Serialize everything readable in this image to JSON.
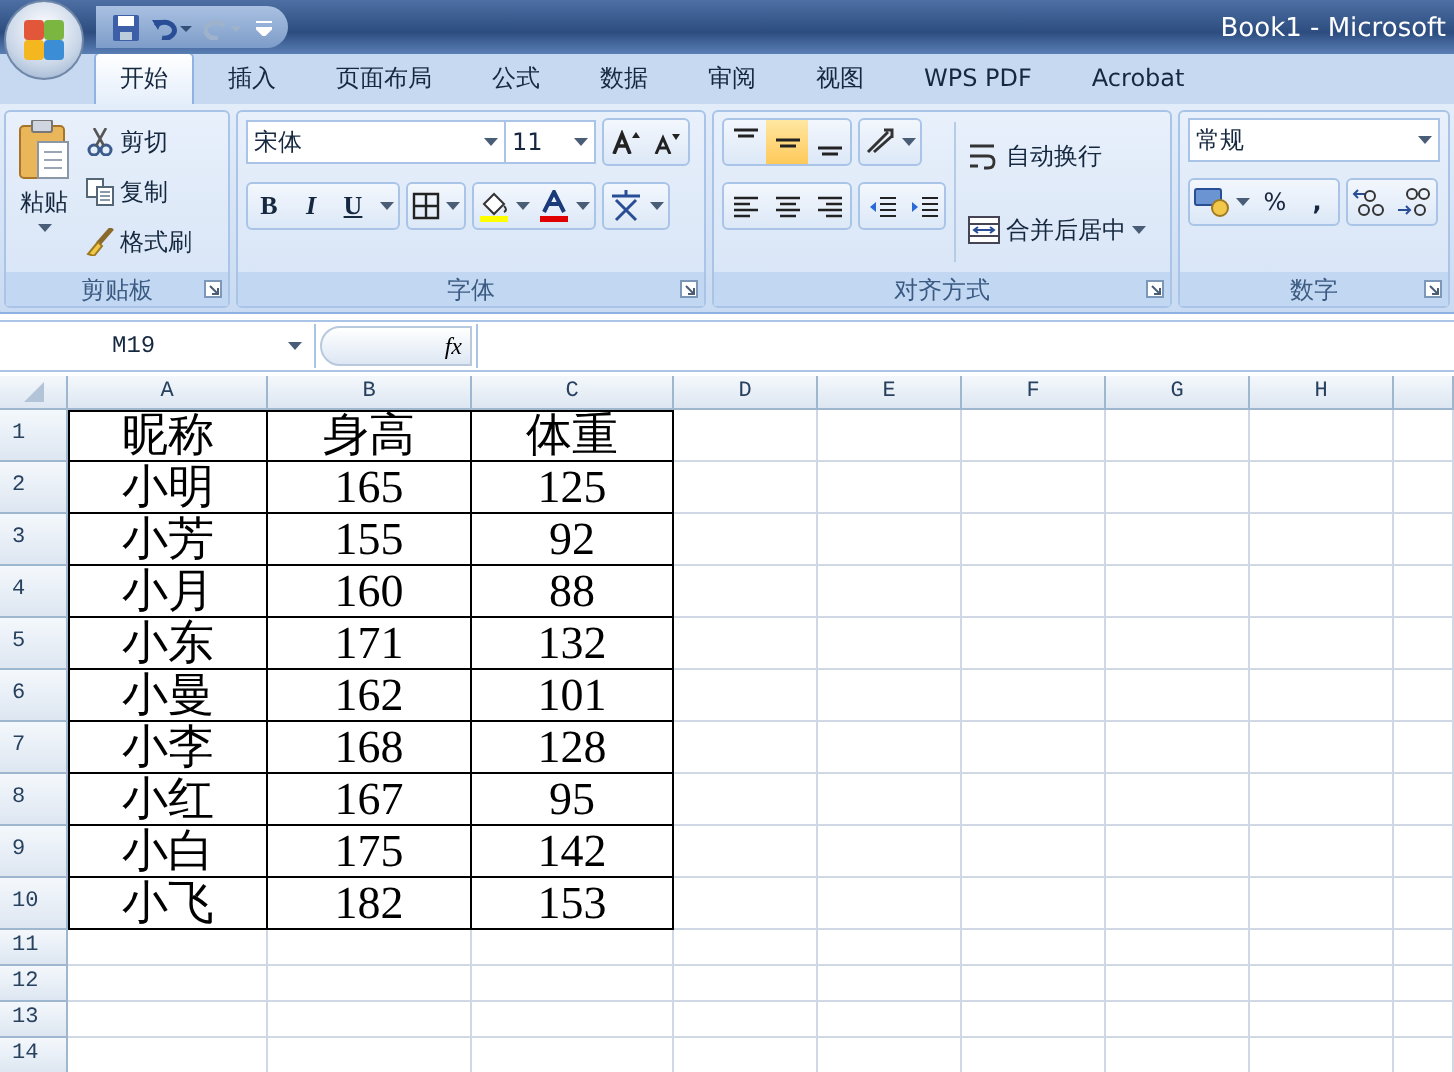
{
  "window": {
    "title": "Book1 - Microsoft"
  },
  "tabs": [
    {
      "label": "开始",
      "selected": true
    },
    {
      "label": "插入",
      "selected": false
    },
    {
      "label": "页面布局",
      "selected": false
    },
    {
      "label": "公式",
      "selected": false
    },
    {
      "label": "数据",
      "selected": false
    },
    {
      "label": "审阅",
      "selected": false
    },
    {
      "label": "视图",
      "selected": false
    },
    {
      "label": "WPS PDF",
      "selected": false
    },
    {
      "label": "Acrobat",
      "selected": false
    }
  ],
  "ribbon": {
    "clipboard": {
      "title": "剪贴板",
      "paste": "粘贴",
      "cut": "剪切",
      "copy": "复制",
      "format_painter": "格式刷"
    },
    "font": {
      "title": "字体",
      "font_name": "宋体",
      "font_size": "11",
      "bold": "B",
      "italic": "I",
      "underline": "U"
    },
    "alignment": {
      "title": "对齐方式",
      "vertical_align": [
        {
          "kind": "top",
          "selected": false
        },
        {
          "kind": "middle",
          "selected": true
        },
        {
          "kind": "bottom",
          "selected": false
        }
      ],
      "wrap_text": "自动换行",
      "merge_center": "合并后居中"
    },
    "number": {
      "title": "数字",
      "format": "常规",
      "percent": "%",
      "comma": ","
    }
  },
  "formula_bar": {
    "name_box": "M19",
    "function_button": "fx"
  },
  "sheet": {
    "columns": [
      "A",
      "B",
      "C",
      "D",
      "E",
      "F",
      "G",
      "H"
    ],
    "rows": [
      {
        "number": "1",
        "cells": [
          "昵称",
          "身高",
          "体重"
        ]
      },
      {
        "number": "2",
        "cells": [
          "小明",
          "165",
          "125"
        ]
      },
      {
        "number": "3",
        "cells": [
          "小芳",
          "155",
          "92"
        ]
      },
      {
        "number": "4",
        "cells": [
          "小月",
          "160",
          "88"
        ]
      },
      {
        "number": "5",
        "cells": [
          "小东",
          "171",
          "132"
        ]
      },
      {
        "number": "6",
        "cells": [
          "小曼",
          "162",
          "101"
        ]
      },
      {
        "number": "7",
        "cells": [
          "小李",
          "168",
          "128"
        ]
      },
      {
        "number": "8",
        "cells": [
          "小红",
          "167",
          "95"
        ]
      },
      {
        "number": "9",
        "cells": [
          "小白",
          "175",
          "142"
        ]
      },
      {
        "number": "10",
        "cells": [
          "小飞",
          "182",
          "153"
        ]
      },
      {
        "number": "11"
      },
      {
        "number": "12"
      },
      {
        "number": "13"
      },
      {
        "number": "14"
      }
    ]
  }
}
